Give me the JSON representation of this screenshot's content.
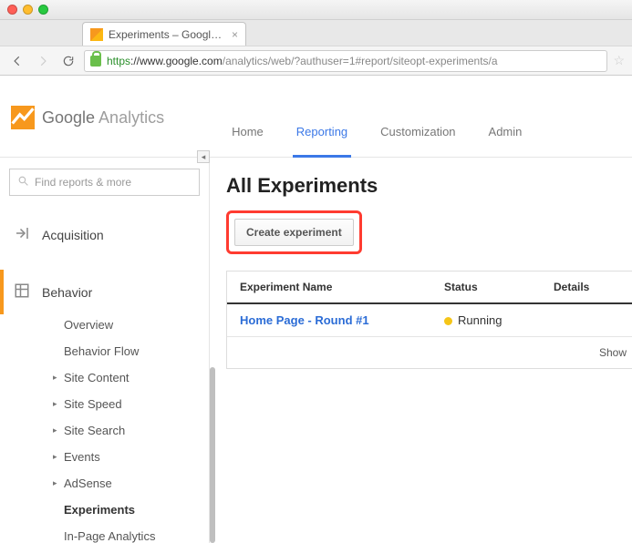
{
  "browser": {
    "tab_title": "Experiments – Google Ana",
    "url_https": "https",
    "url_host": "://www.google.com",
    "url_path": "/analytics/web/?authuser=1#report/siteopt-experiments/a"
  },
  "ga_header": {
    "logo_text_1": "Google",
    "logo_text_2": " Analytics",
    "nav": [
      "Home",
      "Reporting",
      "Customization",
      "Admin"
    ],
    "active_nav_index": 1
  },
  "sidebar": {
    "search_placeholder": "Find reports & more",
    "sections": {
      "acquisition": "Acquisition",
      "behavior": "Behavior"
    },
    "behavior_items": [
      {
        "label": "Overview",
        "has_caret": false
      },
      {
        "label": "Behavior Flow",
        "has_caret": false
      },
      {
        "label": "Site Content",
        "has_caret": true
      },
      {
        "label": "Site Speed",
        "has_caret": true
      },
      {
        "label": "Site Search",
        "has_caret": true
      },
      {
        "label": "Events",
        "has_caret": true
      },
      {
        "label": "AdSense",
        "has_caret": true
      },
      {
        "label": "Experiments",
        "has_caret": false,
        "bold": true
      },
      {
        "label": "In-Page Analytics",
        "has_caret": false
      }
    ]
  },
  "main": {
    "title": "All Experiments",
    "create_button": "Create experiment",
    "columns": {
      "name": "Experiment Name",
      "status": "Status",
      "details": "Details"
    },
    "rows": [
      {
        "name": "Home Page - Round #1",
        "status": "Running",
        "details": ""
      }
    ],
    "footer": "Show"
  }
}
